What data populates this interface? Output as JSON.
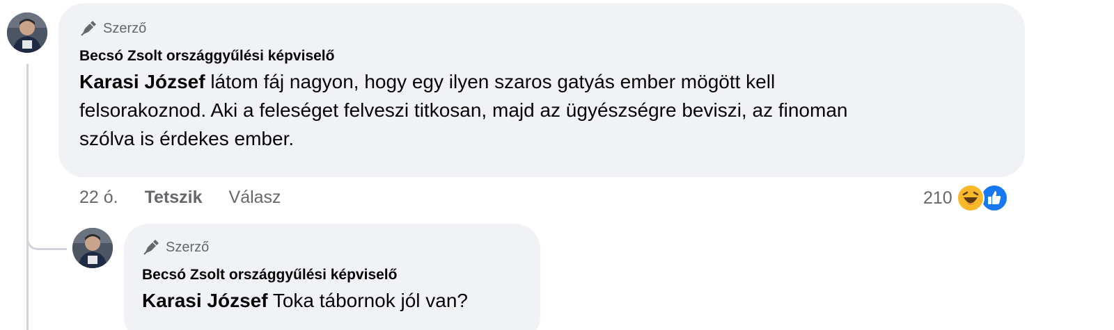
{
  "comments": [
    {
      "badge": "Szerző",
      "author": "Becsó Zsolt országgyűlési képviselő",
      "mention": "Karasi József",
      "text_line1": " látom fáj nagyon, hogy egy ilyen szaros gatyás ember mögött kell",
      "text_line2": "felsorakoznod. Aki a feleséget felveszi titkosan, majd az ügyészségre beviszi, az finoman",
      "text_line3": "szólva is érdekes ember.",
      "time": "22 ó.",
      "like_label": "Tetszik",
      "reply_label": "Válasz",
      "reaction_count": "210",
      "reactions": [
        "haha-icon",
        "like-icon"
      ]
    },
    {
      "badge": "Szerző",
      "author": "Becsó Zsolt országgyűlési képviselő",
      "mention": "Karasi József",
      "text": " Toka tábornok jól van?"
    }
  ],
  "colors": {
    "bubble": "#f0f2f5",
    "secondary_text": "#65676b",
    "like_blue": "#1877f2",
    "haha_yellow": "#f7b928"
  }
}
